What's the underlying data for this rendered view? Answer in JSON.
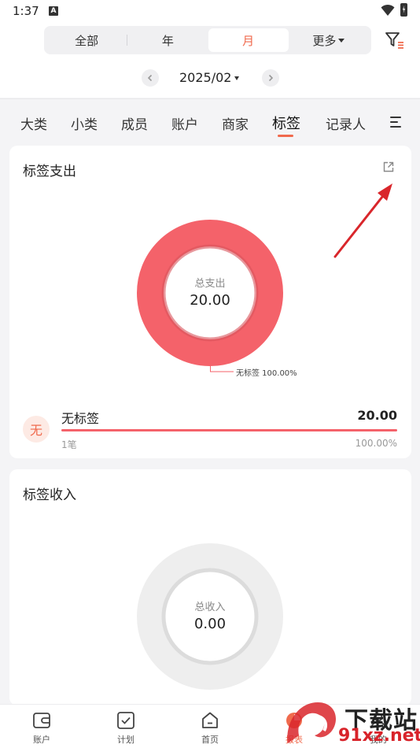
{
  "status": {
    "time": "1:37",
    "notification_glyph": "A"
  },
  "period": {
    "options": [
      "全部",
      "年",
      "月",
      "更多"
    ],
    "active_index": 2
  },
  "date": {
    "label": "2025/02"
  },
  "tabs": {
    "items": [
      "大类",
      "小类",
      "成员",
      "账户",
      "商家",
      "标签",
      "记录人"
    ],
    "active": "标签"
  },
  "expense_card": {
    "title": "标签支出",
    "donut": {
      "center_label": "总支出",
      "center_value": "20.00",
      "color": "#f4626a"
    },
    "legend": "无标签 100.00%",
    "rows": [
      {
        "avatar": "无",
        "name": "无标签",
        "amount": "20.00",
        "count": "1笔",
        "percent": "100.00%",
        "ratio": 1.0
      }
    ]
  },
  "income_card": {
    "title": "标签收入",
    "donut": {
      "center_label": "总收入",
      "center_value": "0.00",
      "color": "#eeeeee"
    }
  },
  "bottom_nav": [
    {
      "label": "账户",
      "icon": "wallet-icon"
    },
    {
      "label": "计划",
      "icon": "checklist-icon"
    },
    {
      "label": "首页",
      "icon": "home-icon"
    },
    {
      "label": "报表",
      "icon": "chart-icon",
      "active": true
    },
    {
      "label": "我的",
      "icon": "profile-icon"
    }
  ],
  "watermark": {
    "line1": "下载站",
    "line2": "91xz.net"
  },
  "colors": {
    "accent": "#f06a4d",
    "expense": "#f4626a",
    "arrow": "#d9262b"
  }
}
